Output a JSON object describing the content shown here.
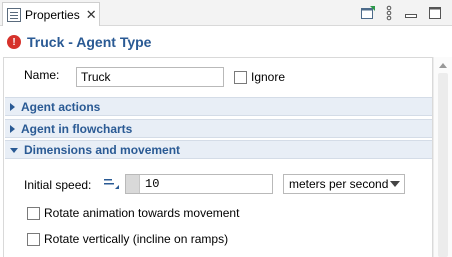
{
  "tab": {
    "label": "Properties",
    "close": "✕"
  },
  "header": {
    "title": "Truck - Agent Type",
    "error_symbol": "!"
  },
  "name_row": {
    "label": "Name:",
    "value": "Truck",
    "ignore_label": "Ignore",
    "ignore_checked": false
  },
  "sections": [
    {
      "label": "Agent actions",
      "expanded": false
    },
    {
      "label": "Agent in flowcharts",
      "expanded": false
    },
    {
      "label": "Dimensions and movement",
      "expanded": true
    }
  ],
  "dimensions": {
    "speed_label": "Initial speed:",
    "speed_value": "10",
    "speed_unit": "meters per second",
    "rotate_label": "Rotate animation towards movement",
    "rotate_checked": false,
    "incline_label": "Rotate vertically (incline on ramps)",
    "incline_checked": false
  },
  "colors": {
    "accent": "#2a5a94",
    "section_bg": "#e8eef6",
    "error": "#d6322b"
  },
  "icons": [
    "properties-tab-icon",
    "pin-view-icon",
    "view-menu-icon",
    "minimize-icon",
    "maximize-icon",
    "error-icon",
    "dynamic-value-icon"
  ]
}
